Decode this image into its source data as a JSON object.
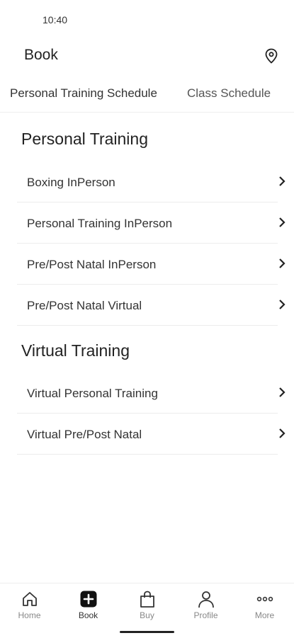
{
  "status_bar": {
    "time": "10:40"
  },
  "header": {
    "title": "Book",
    "location_icon": "location-pin-icon"
  },
  "tabs": [
    {
      "label": "Personal Training Schedule"
    },
    {
      "label": "Class Schedule"
    }
  ],
  "sections": [
    {
      "title": "Personal Training",
      "items": [
        {
          "label": "Boxing InPerson"
        },
        {
          "label": "Personal Training InPerson"
        },
        {
          "label": "Pre/Post Natal InPerson"
        },
        {
          "label": "Pre/Post Natal Virtual"
        }
      ]
    },
    {
      "title": "Virtual Training",
      "items": [
        {
          "label": "Virtual Personal Training"
        },
        {
          "label": "Virtual Pre/Post Natal"
        }
      ]
    }
  ],
  "bottom_nav": {
    "items": [
      {
        "label": "Home",
        "icon": "home-icon"
      },
      {
        "label": "Book",
        "icon": "book-plus-icon",
        "active": true
      },
      {
        "label": "Buy",
        "icon": "shopping-bag-icon"
      },
      {
        "label": "Profile",
        "icon": "profile-icon"
      },
      {
        "label": "More",
        "icon": "more-icon"
      }
    ]
  }
}
